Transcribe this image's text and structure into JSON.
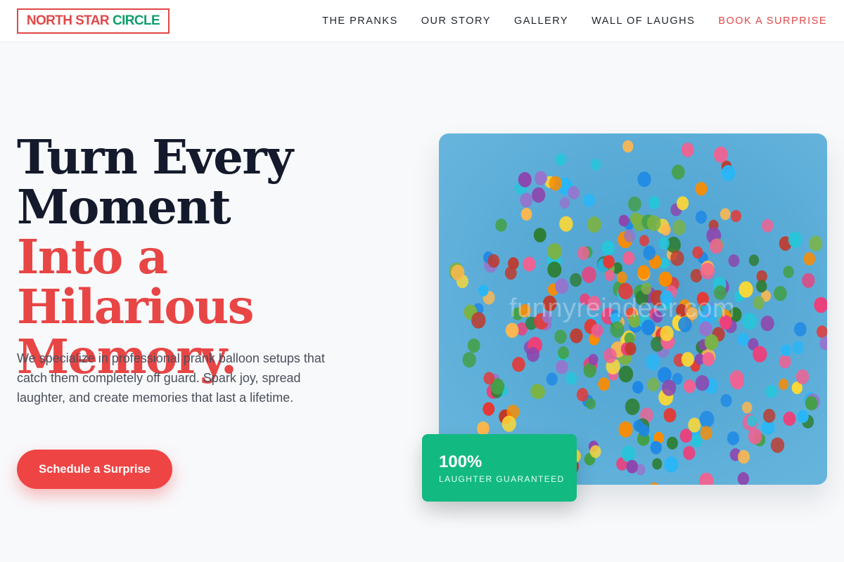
{
  "header": {
    "logo": {
      "word1": "NORTH STAR",
      "word2": "CIRCLE"
    },
    "nav": [
      {
        "label": "THE PRANKS"
      },
      {
        "label": "OUR STORY"
      },
      {
        "label": "GALLERY"
      },
      {
        "label": "WALL OF LAUGHS"
      },
      {
        "label": "BOOK A SURPRISE"
      }
    ]
  },
  "hero": {
    "headline": {
      "line1": "Turn Every",
      "line2": "Moment",
      "line3": "Into a Hilarious",
      "line4": "Memory."
    },
    "description": "We specialize in professional prank balloon setups that catch them completely off guard. Spark joy, spread laughter, and create memories that last a lifetime.",
    "cta_label": "Schedule a Surprise",
    "image": {
      "subject": "colorful balloons on blue background",
      "watermark": "funnyreindeer.com"
    },
    "badge": {
      "value": "100%",
      "label": "LAUGHTER GUARANTEED"
    }
  },
  "colors": {
    "accent_red": "#ef4444",
    "accent_green": "#12b981",
    "logo_green": "#0f9d6b",
    "headline_dark": "#141a2b",
    "image_blue": "#5badd8"
  }
}
